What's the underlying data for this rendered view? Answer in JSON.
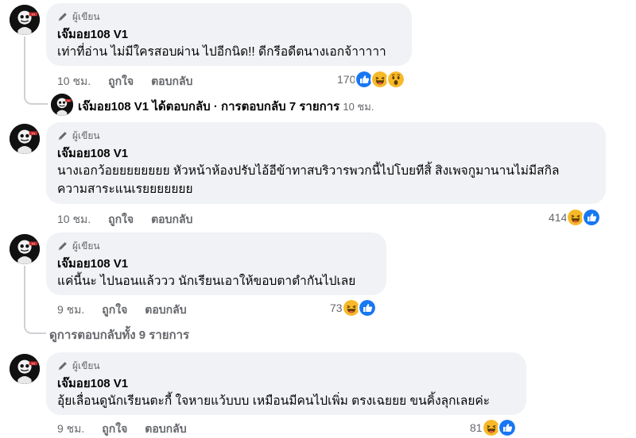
{
  "badge_label": "ผู้เขียน",
  "actions": {
    "like": "ถูกใจ",
    "reply": "ตอบกลับ"
  },
  "comments": [
    {
      "author": "เจ๊มอย108 V1",
      "text_lines": [
        "เท่าที่อ่าน ไม่มีใครสอบผ่าน ไปอีกนิด!! ดีกรีอดีตนางเอกจ้าาาาา"
      ],
      "time": "10 ชม.",
      "reaction_count": "170",
      "reactions": [
        "like-icon",
        "haha-icon",
        "wow-icon"
      ]
    },
    {
      "author": "เจ๊มอย108 V1",
      "text_lines": [
        "นางเอกว้อยยยยยยยย หัวหน้าห้องปรับไอ้อีข้าทาสบริวารพวกนี้ไปโบยทีสิ้ สิงเพจกูมานานไม่มีสกิล",
        "ความสาระแนเรยยยยยยย"
      ],
      "time": "10 ชม.",
      "reaction_count": "414",
      "reactions": [
        "haha-icon",
        "like-icon"
      ]
    },
    {
      "author": "เจ๊มอย108 V1",
      "text_lines": [
        "แค่นี้นะ ไปนอนแล้ววว นักเรียนเอาให้ขอบตาตำกันไปเลย"
      ],
      "time": "9 ชม.",
      "reaction_count": "73",
      "reactions": [
        "haha-icon",
        "like-icon"
      ]
    },
    {
      "author": "เจ๊มอย108 V1",
      "text_lines": [
        "อุ้ยเลื่อนดูนักเรียนตะกี้ ใจหายแว้บบบ เหมือนมีคนไปเพิ่ม ตรงเฉยยย ขนคิ้งลุกเลยค่ะ"
      ],
      "time": "9 ชม.",
      "reaction_count": "81",
      "reactions": [
        "haha-icon",
        "like-icon"
      ]
    }
  ],
  "reply_summary": {
    "author": "เจ๊มอย108 V1",
    "action": "ได้ตอบกลับ",
    "separator": "·",
    "count_text": "การตอบกลับ 7 รายการ",
    "time": "10 ชม."
  },
  "view_replies": "ดูการตอบกลับทั้ง 9 รายการ",
  "colors": {
    "bubble": "#f0f2f5",
    "secondary_text": "#65676b",
    "like_blue": "#1877f2",
    "haha_yellow": "#f7b928"
  }
}
